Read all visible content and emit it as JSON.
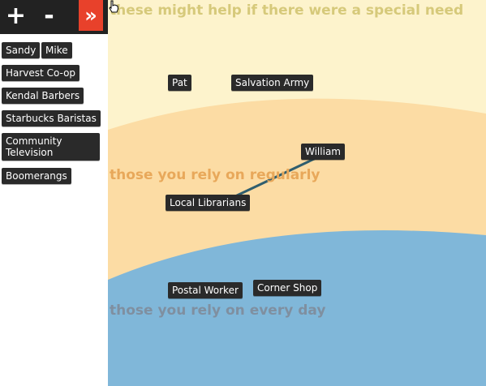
{
  "toolbar": {
    "add_glyph": "+",
    "remove_glyph": "-",
    "expand_glyph": "»",
    "accent": "#e8412b"
  },
  "sidebar": {
    "items": [
      {
        "label": "Sandy"
      },
      {
        "label": "Mike"
      },
      {
        "label": "Harvest Co-op"
      },
      {
        "label": "Kendal Barbers"
      },
      {
        "label": "Starbucks Baristas"
      },
      {
        "label": "Community Television"
      },
      {
        "label": "Boomerangs"
      }
    ]
  },
  "zones": {
    "special": {
      "label": "these might help if there were a special need",
      "color": "#fdf3cc"
    },
    "regular": {
      "label": "those you rely on regularly",
      "color": "#fcdca4"
    },
    "daily": {
      "label": "those you rely on every day",
      "color": "#80b7d9"
    }
  },
  "nodes": {
    "pat": "Pat",
    "salvation_army": "Salvation Army",
    "william": "William",
    "local_librarians": "Local Librarians",
    "postal_worker": "Postal Worker",
    "corner_shop": "Corner Shop"
  },
  "connections": [
    {
      "from": "william",
      "to": "local_librarians",
      "color": "#2f5e6e"
    }
  ]
}
